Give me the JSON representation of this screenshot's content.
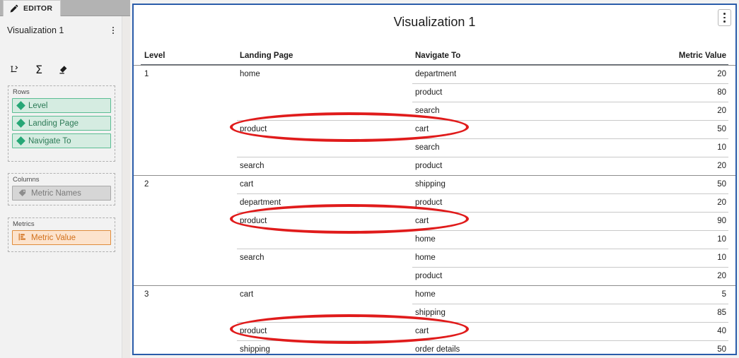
{
  "editor": {
    "tab_label": "EDITOR",
    "tab_icon": "pencil-icon",
    "visualization_name": "Visualization 1",
    "more_menu_icon": "kebab-menu-icon",
    "toolbar": [
      {
        "name": "drill-icon",
        "title": "Drill"
      },
      {
        "name": "sigma-icon",
        "title": "Totals",
        "glyph": "Σ"
      },
      {
        "name": "eraser-icon",
        "title": "Clear"
      }
    ],
    "shelves": [
      {
        "label": "Rows",
        "chips": [
          {
            "label": "Level",
            "icon": "attribute-diamond-icon",
            "kind": "attribute"
          },
          {
            "label": "Landing Page",
            "icon": "attribute-diamond-icon",
            "kind": "attribute"
          },
          {
            "label": "Navigate To",
            "icon": "attribute-diamond-icon",
            "kind": "attribute"
          }
        ]
      },
      {
        "label": "Columns",
        "chips": [
          {
            "label": "Metric Names",
            "icon": "tag-icon",
            "kind": "grey"
          }
        ]
      },
      {
        "label": "Metrics",
        "chips": [
          {
            "label": "Metric Value",
            "icon": "bar-chart-icon",
            "kind": "metric"
          }
        ]
      }
    ]
  },
  "visualization": {
    "title": "Visualization 1",
    "menu_icon": "kebab-menu-icon"
  },
  "chart_data": {
    "type": "table",
    "title": "Visualization 1",
    "columns": [
      "Level",
      "Landing Page",
      "Navigate To",
      "Metric Value"
    ],
    "rows": [
      {
        "level": "1",
        "landing": "home",
        "navigate": "department",
        "value": "20",
        "sep": "level"
      },
      {
        "level": "",
        "landing": "",
        "navigate": "product",
        "value": "80",
        "sep": "nav"
      },
      {
        "level": "",
        "landing": "",
        "navigate": "search",
        "value": "20",
        "sep": "nav"
      },
      {
        "level": "",
        "landing": "product",
        "navigate": "cart",
        "value": "50",
        "sep": "land"
      },
      {
        "level": "",
        "landing": "",
        "navigate": "search",
        "value": "10",
        "sep": "nav"
      },
      {
        "level": "",
        "landing": "search",
        "navigate": "product",
        "value": "20",
        "sep": "land"
      },
      {
        "level": "2",
        "landing": "cart",
        "navigate": "shipping",
        "value": "50",
        "sep": "level"
      },
      {
        "level": "",
        "landing": "department",
        "navigate": "product",
        "value": "20",
        "sep": "land"
      },
      {
        "level": "",
        "landing": "product",
        "navigate": "cart",
        "value": "90",
        "sep": "land"
      },
      {
        "level": "",
        "landing": "",
        "navigate": "home",
        "value": "10",
        "sep": "nav"
      },
      {
        "level": "",
        "landing": "search",
        "navigate": "home",
        "value": "10",
        "sep": "land"
      },
      {
        "level": "",
        "landing": "",
        "navigate": "product",
        "value": "20",
        "sep": "nav"
      },
      {
        "level": "3",
        "landing": "cart",
        "navigate": "home",
        "value": "5",
        "sep": "level"
      },
      {
        "level": "",
        "landing": "",
        "navigate": "shipping",
        "value": "85",
        "sep": "nav"
      },
      {
        "level": "",
        "landing": "product",
        "navigate": "cart",
        "value": "40",
        "sep": "land"
      },
      {
        "level": "",
        "landing": "shipping",
        "navigate": "order details",
        "value": "50",
        "sep": "land"
      }
    ]
  },
  "annotations": [
    {
      "name": "highlight-ellipse-product-cart-1",
      "shape": "ellipse",
      "color": "#e01b1b",
      "row_index": 3
    },
    {
      "name": "highlight-ellipse-product-cart-2",
      "shape": "ellipse",
      "color": "#e01b1b",
      "row_index": 8
    },
    {
      "name": "highlight-ellipse-product-cart-3",
      "shape": "ellipse",
      "color": "#e01b1b",
      "row_index": 14
    }
  ]
}
